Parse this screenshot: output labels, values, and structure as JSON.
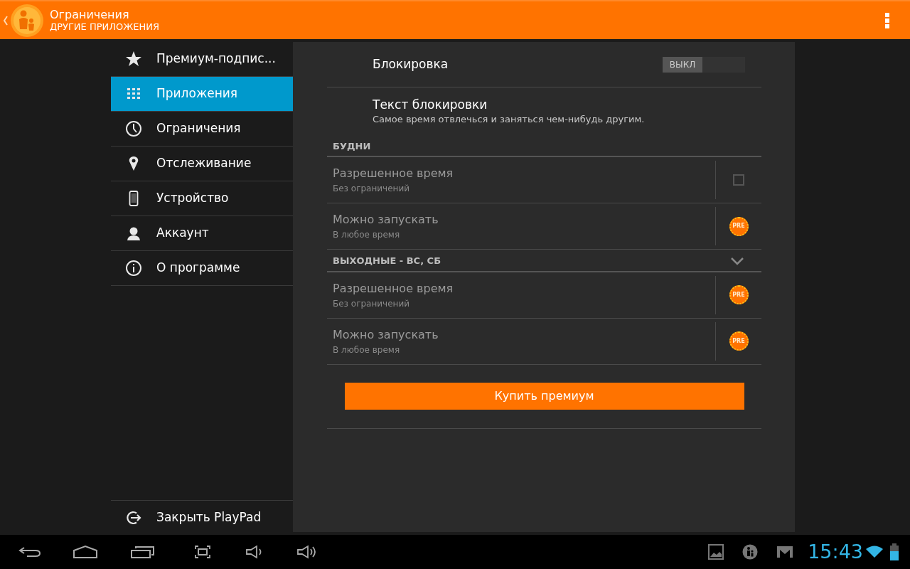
{
  "app_bar": {
    "title": "Ограничения",
    "subtitle": "ДРУГИЕ ПРИЛОЖЕНИЯ"
  },
  "sidebar": {
    "items": [
      {
        "label": "Премиум-подпис...",
        "selected": false
      },
      {
        "label": "Приложения",
        "selected": true
      },
      {
        "label": "Ограничения",
        "selected": false
      },
      {
        "label": "Отслеживание",
        "selected": false
      },
      {
        "label": "Устройство",
        "selected": false
      },
      {
        "label": "Аккаунт",
        "selected": false
      },
      {
        "label": "О программе",
        "selected": false
      }
    ],
    "footer_item": {
      "label": "Закрыть PlayPad"
    }
  },
  "lock": {
    "label": "Блокировка",
    "on": false,
    "switch_label": "ВЫКЛ"
  },
  "lock_text": {
    "title": "Текст блокировки",
    "subtitle": "Самое время отвлечься и заняться чем-нибудь другим."
  },
  "sections": [
    {
      "title": "БУДНИ",
      "expandable": false,
      "rows": [
        {
          "title": "Разрешенное время",
          "subtitle": "Без ограничений",
          "disabled": true,
          "kind": "checkbox",
          "checked": false
        },
        {
          "title": "Можно запускать",
          "subtitle": "В любое время",
          "disabled": true,
          "kind": "premium",
          "badge": "PRE"
        }
      ]
    },
    {
      "title": "ВЫХОДНЫЕ - ВС, СБ",
      "expandable": true,
      "rows": [
        {
          "title": "Разрешенное время",
          "subtitle": "Без ограничений",
          "disabled": true,
          "kind": "premium",
          "badge": "PRE"
        },
        {
          "title": "Можно запускать",
          "subtitle": "В любое время",
          "disabled": true,
          "kind": "premium",
          "badge": "PRE"
        }
      ]
    }
  ],
  "buy_button": "Купить премиум",
  "status_bar": {
    "time": "15:43"
  }
}
